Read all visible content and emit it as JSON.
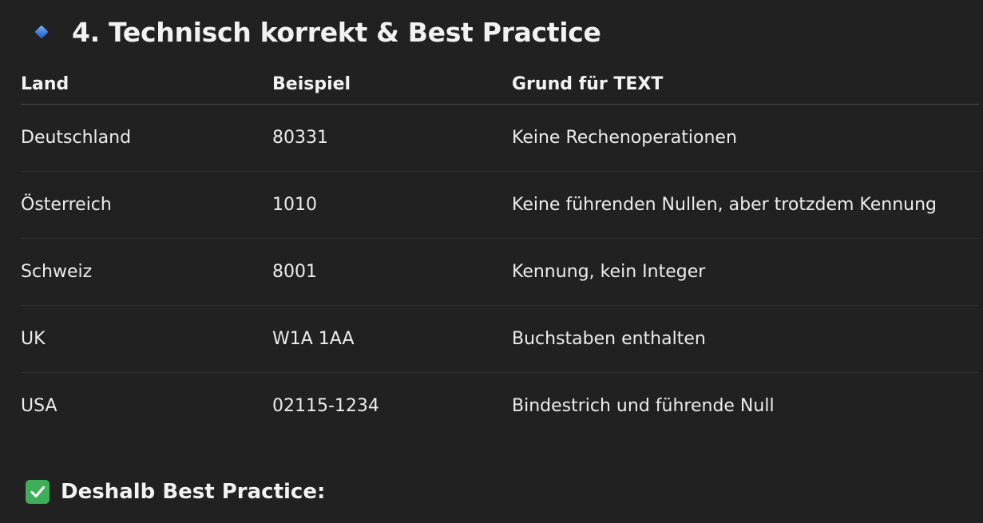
{
  "section": {
    "heading": "4. Technisch korrekt & Best Practice",
    "heading_icon": "blue-diamond-icon"
  },
  "table": {
    "headers": [
      "Land",
      "Beispiel",
      "Grund für TEXT"
    ],
    "rows": [
      [
        "Deutschland",
        "80331",
        "Keine Rechenoperationen"
      ],
      [
        "Österreich",
        "1010",
        "Keine führenden Nullen, aber trotzdem Kennung"
      ],
      [
        "Schweiz",
        "8001",
        "Kennung, kein Integer"
      ],
      [
        "UK",
        "W1A 1AA",
        "Buchstaben enthalten"
      ],
      [
        "USA",
        "02115-1234",
        "Bindestrich und führende Null"
      ]
    ]
  },
  "subsection": {
    "heading": "Deshalb Best Practice:",
    "heading_icon": "check-mark-button-icon"
  },
  "colors": {
    "background": "#212121",
    "text": "#ececec",
    "diamond": "#3f7fe0",
    "check": "#3fae5a"
  }
}
